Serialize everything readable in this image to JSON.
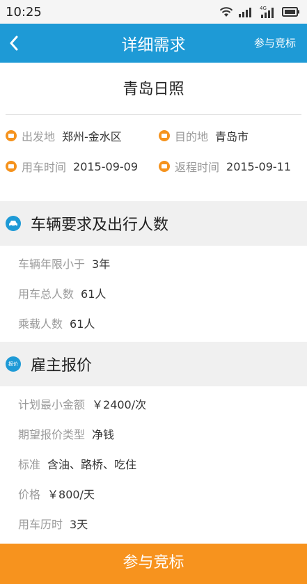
{
  "status_bar": {
    "time": "10:25",
    "network": "4G"
  },
  "nav": {
    "title": "详细需求",
    "action": "参与竞标",
    "back_icon": "chevron-left-icon"
  },
  "route_title": "青岛日照",
  "trip": {
    "from_label": "出发地",
    "from_value": "郑州-金水区",
    "to_label": "目的地",
    "to_value": "青岛市",
    "start_label": "用车时间",
    "start_value": "2015-09-09",
    "return_label": "返程时间",
    "return_value": "2015-09-11"
  },
  "vehicle_section": {
    "title": "车辆要求及出行人数",
    "icon": "car-icon",
    "rows": [
      {
        "label": "车辆年限小于",
        "value": "3年"
      },
      {
        "label": "用车总人数",
        "value": "61人"
      },
      {
        "label": "乘载人数",
        "value": "61人"
      }
    ]
  },
  "quote_section": {
    "title": "雇主报价",
    "icon_text": "报价",
    "rows": [
      {
        "label": "计划最小金额",
        "value": "￥2400/次"
      },
      {
        "label": "期望报价类型",
        "value": "净钱"
      },
      {
        "label": "标准",
        "value": "含油、路桥、吃住"
      },
      {
        "label": "价格",
        "value": "￥800/天"
      },
      {
        "label": "用车历时",
        "value": "3天"
      }
    ]
  },
  "bottom_button": "参与竞标",
  "colors": {
    "primary": "#1e9ad6",
    "accent": "#f7931e",
    "section_bg": "#f0f0f0"
  }
}
